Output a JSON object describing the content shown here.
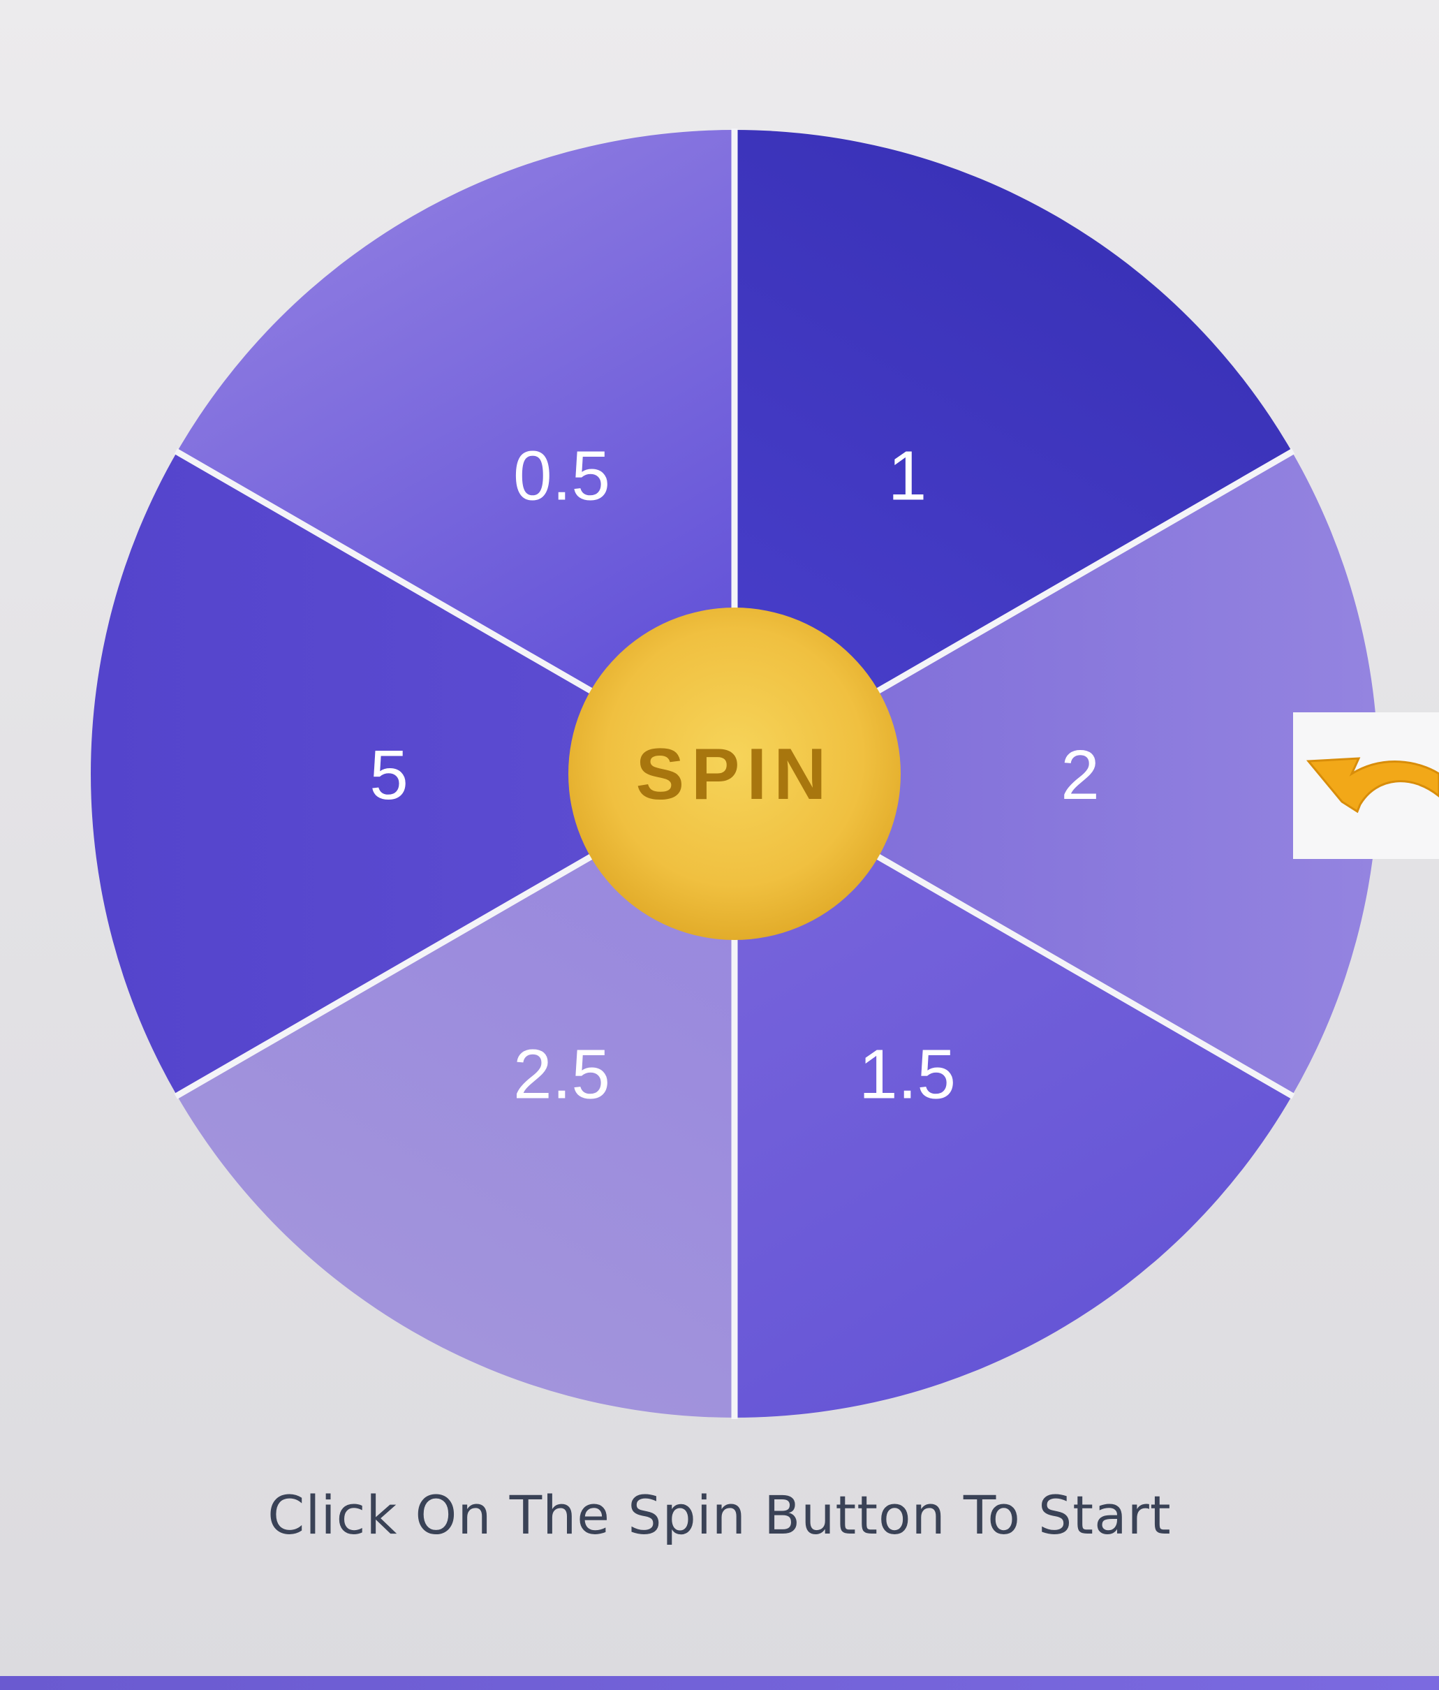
{
  "wheel": {
    "segments": [
      {
        "label": "1",
        "color_a": "#3a32b8",
        "color_b": "#4a40cc"
      },
      {
        "label": "2",
        "color_a": "#9484e0",
        "color_b": "#7d6bd8"
      },
      {
        "label": "1.5",
        "color_a": "#6656d6",
        "color_b": "#7a66dc"
      },
      {
        "label": "2.5",
        "color_a": "#a294dc",
        "color_b": "#9786de"
      },
      {
        "label": "5",
        "color_a": "#5444cc",
        "color_b": "#5e4ed2"
      },
      {
        "label": "0.5",
        "color_a": "#8a78e0",
        "color_b": "#5a4ad6"
      }
    ],
    "divider_color": "#f4f4f8"
  },
  "spin_button": {
    "label": "SPIN",
    "color": "#f0c040",
    "text_color": "#a8760e"
  },
  "pointer": {
    "icon": "curved-arrow-pointer-icon",
    "color": "#f2a818"
  },
  "instruction": {
    "text": "Click On The Spin Button To Start"
  }
}
